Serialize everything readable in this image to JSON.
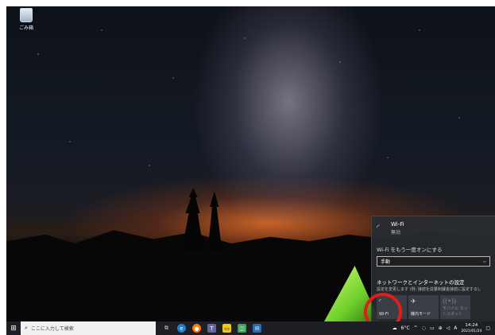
{
  "desktop": {
    "recycle_bin_label": "ごみ箱"
  },
  "flyout": {
    "wifi_name": "Wi-Fi",
    "wifi_status": "無効",
    "reenable_label": "Wi-Fi をもう一度オンにする",
    "reenable_option": "手動",
    "settings_title": "ネットワークとインターネットの設定",
    "settings_desc": "設定を変更します (例: 接続を従量制課金接続に設定する)。",
    "tiles": [
      {
        "label": "Wi-Fi",
        "icon": "wifi-icon",
        "glyph": "◜"
      },
      {
        "label": "機内モード",
        "icon": "airplane-icon",
        "glyph": "✈"
      },
      {
        "label": "モバイル ホットスポット",
        "icon": "hotspot-icon",
        "glyph": "((•))"
      }
    ]
  },
  "taskbar": {
    "search_placeholder": "ここに入力して検索",
    "weather": "6°C",
    "ime": "A",
    "time": "14:24",
    "date": "2021/01/24"
  },
  "colors": {
    "highlight": "#e21b1b",
    "taskbar": "#1d1f24",
    "flyout_bg": "#282c32"
  }
}
